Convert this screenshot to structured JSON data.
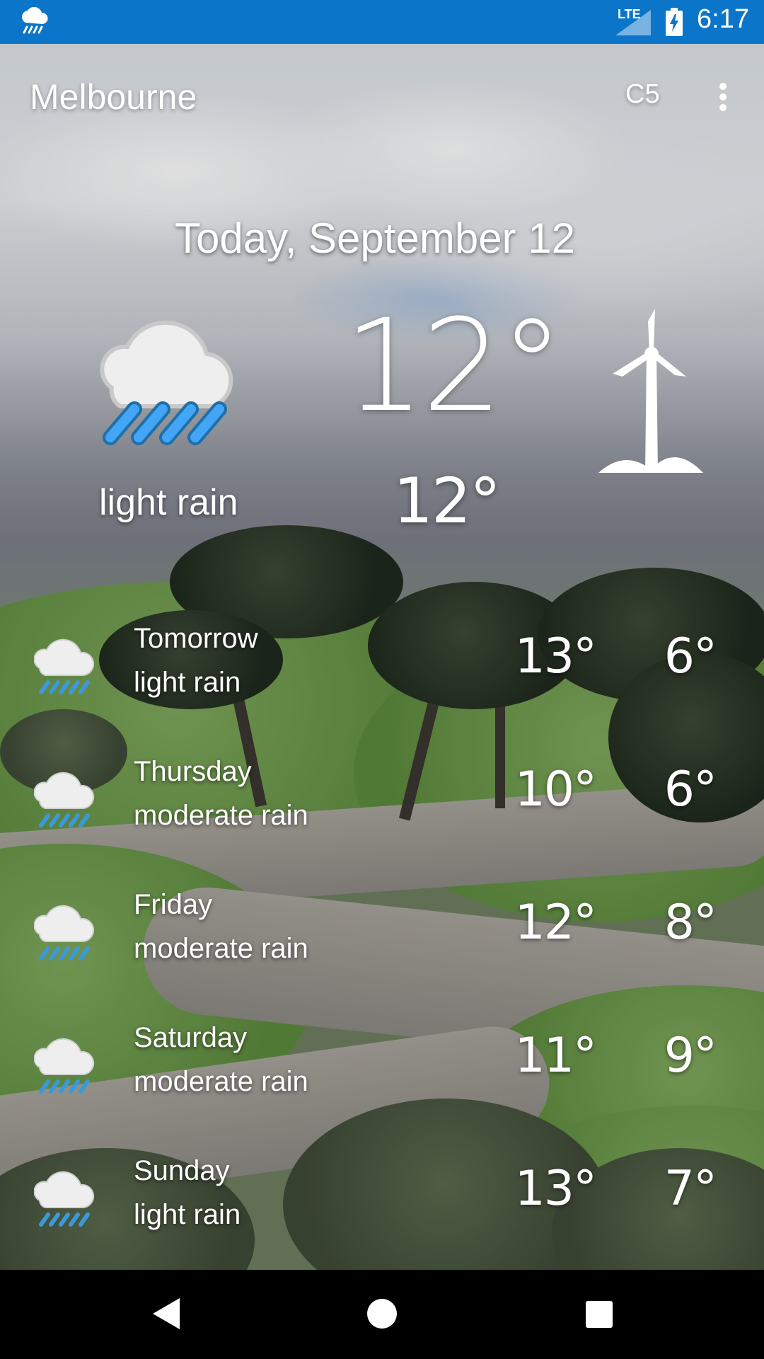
{
  "status_bar": {
    "network": "LTE",
    "time": "6:17",
    "icons": [
      "weather-rain-icon",
      "signal-icon",
      "battery-charging-icon"
    ]
  },
  "app_bar": {
    "city": "Melbourne",
    "unit_button": "C5",
    "menu_icon": "overflow-menu-icon"
  },
  "today": {
    "date": "Today, September 12",
    "condition": "light rain",
    "high": "12°",
    "low": "12°",
    "icon": "cloud-rain-icon",
    "wind_icon": "wind-turbine-icon"
  },
  "forecast": [
    {
      "day": "Tomorrow",
      "condition": "light rain",
      "high": "13°",
      "low": "6°",
      "icon": "cloud-rain-icon"
    },
    {
      "day": "Thursday",
      "condition": "moderate rain",
      "high": "10°",
      "low": "6°",
      "icon": "cloud-rain-icon"
    },
    {
      "day": "Friday",
      "condition": "moderate rain",
      "high": "12°",
      "low": "8°",
      "icon": "cloud-rain-icon"
    },
    {
      "day": "Saturday",
      "condition": "moderate rain",
      "high": "11°",
      "low": "9°",
      "icon": "cloud-rain-icon"
    },
    {
      "day": "Sunday",
      "condition": "light rain",
      "high": "13°",
      "low": "7°",
      "icon": "cloud-rain-icon"
    }
  ],
  "nav_bar": {
    "buttons": [
      "back-icon",
      "home-icon",
      "recents-icon"
    ]
  },
  "colors": {
    "status_bar": "#0a75c9",
    "rain_blue": "#3a9ad9",
    "cloud": "#eeeeee",
    "text": "#ffffff"
  }
}
